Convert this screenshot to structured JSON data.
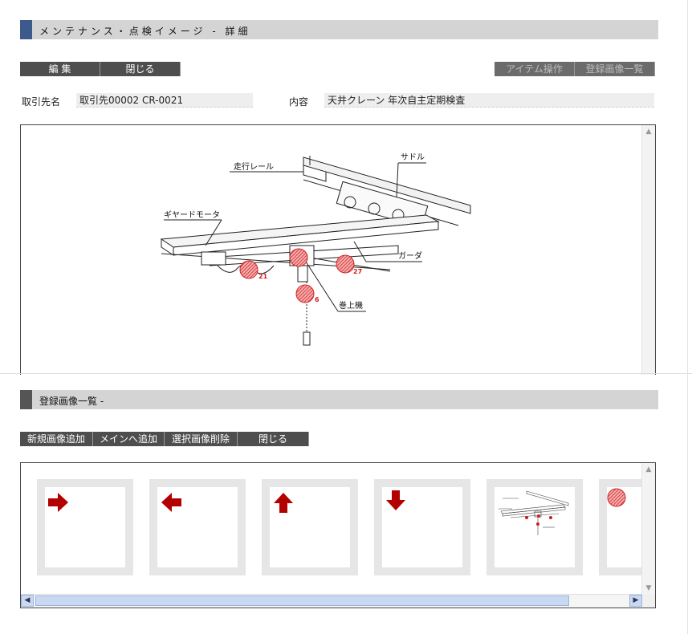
{
  "header": {
    "title": "メンテナンス・点検イメージ - 詳細",
    "accent_color": "#3c5a8c"
  },
  "toolbar": {
    "edit_label": "編 集",
    "close_label": "閉じる",
    "item_ops_label": "アイテム操作",
    "image_list_label": "登録画像一覧"
  },
  "fields": {
    "client_label": "取引先名",
    "client_value": "取引先00002 CR-0021",
    "content_label": "内容",
    "content_value": "天井クレーン 年次自主定期検査"
  },
  "diagram": {
    "labels": {
      "rail": "走行レール",
      "saddle": "サドル",
      "geared_motor": "ギヤードモータ",
      "girder": "ガーダ",
      "hoist": "巻上機"
    },
    "markers": [
      {
        "number": "21"
      },
      {
        "number": "27"
      },
      {
        "number": "6"
      }
    ],
    "marker_color": "#cc1f1f"
  },
  "gallery": {
    "title": "登録画像一覧 -",
    "accent_color": "#555555",
    "buttons": {
      "add_new": "新規画像追加",
      "add_main": "メインへ追加",
      "delete_selected": "選択画像削除",
      "close": "閉じる"
    },
    "thumbnails": [
      {
        "icon": "arrow-right-icon"
      },
      {
        "icon": "arrow-left-icon"
      },
      {
        "icon": "arrow-up-icon"
      },
      {
        "icon": "arrow-down-icon"
      },
      {
        "icon": "crane-diagram-thumbnail"
      },
      {
        "icon": "red-marker-icon"
      }
    ],
    "arrow_color": "#b30000"
  }
}
